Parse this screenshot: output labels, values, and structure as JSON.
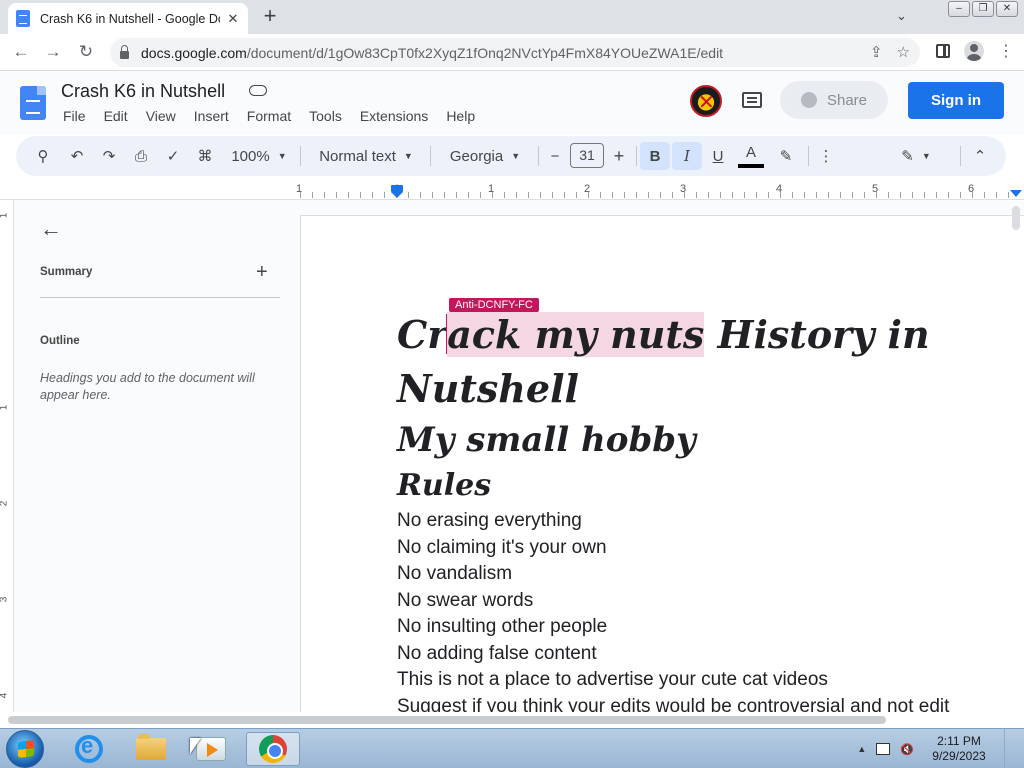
{
  "browser": {
    "tab_title": "Crash K6 in Nutshell - Google Docs",
    "tab_close": "✕",
    "new_tab": "+",
    "tab_search": "⌄",
    "url_host": "docs.google.com",
    "url_path": "/document/d/1gOw83CpT0fx2XyqZ1fOnq2NVctYp4FmX84YOUeZWA1E/edit",
    "window_buttons": [
      "‒",
      "❐",
      "✕"
    ],
    "nav": {
      "back": "←",
      "forward": "→",
      "reload": "↻"
    },
    "share_page_icon": "share-icon",
    "bookmark_icon": "star-icon"
  },
  "docs": {
    "title": "Crash K6 in Nutshell",
    "menu": [
      "File",
      "Edit",
      "View",
      "Insert",
      "Format",
      "Tools",
      "Extensions",
      "Help"
    ],
    "share_label": "Share",
    "signin_label": "Sign in",
    "accent": "#1a73e8"
  },
  "toolbar": {
    "zoom": "100%",
    "style": "Normal text",
    "font": "Georgia",
    "font_size": "31",
    "minus": "−",
    "plus": "+",
    "bold": "B",
    "italic": "I",
    "underline": "U",
    "text_color": "A",
    "more": "⋮",
    "edit_mode": "✎",
    "collapse": "⌃"
  },
  "ruler": {
    "labels": [
      "1",
      "1",
      "1",
      "2",
      "3",
      "4",
      "5",
      "6"
    ],
    "vlabels": [
      "1",
      "1",
      "2",
      "3",
      "4"
    ]
  },
  "outline": {
    "back": "←",
    "summary": "Summary",
    "summary_add": "+",
    "title": "Outline",
    "hint": "Headings you add to the document will appear here."
  },
  "document": {
    "cursor_user": "Anti-DCNFY-FC",
    "title_pre": "Cr",
    "title_highlight": "ack my nuts",
    "title_post": " History in",
    "title_line2": "Nutshell",
    "subtitle": "My small hobby",
    "rules_heading": "Rules",
    "rules": [
      "No erasing everything",
      "No claiming it's your own",
      "No vandalism",
      "No swear words",
      "No insulting other people",
      "No adding false content",
      "This is not a place to advertise your cute cat videos",
      "Suggest if you think your edits would be controversial and not edit"
    ]
  },
  "taskbar": {
    "time": "2:11 PM",
    "date": "9/29/2023",
    "tray_arrow": "▲"
  }
}
